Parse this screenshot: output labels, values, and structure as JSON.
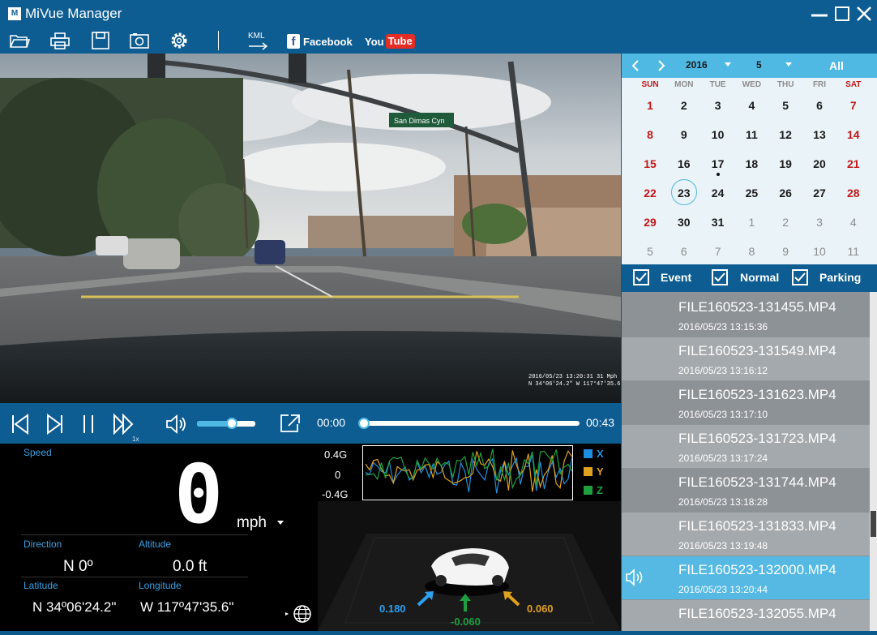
{
  "window": {
    "title": "MiVue Manager",
    "logo_text": "M"
  },
  "toolbar": {
    "icons": [
      "open-folder-icon",
      "print-icon",
      "save-icon",
      "snapshot-icon",
      "settings-icon",
      "kml-export-icon"
    ],
    "kml_label": "KML",
    "facebook_label": "Facebook",
    "youtube_you": "You",
    "youtube_tube": "Tube"
  },
  "video": {
    "overlay_line1": "2016/05/23 13:20:31 31 Mph",
    "overlay_line2": "N 34°06'24.2\" W 117°47'35.6\"",
    "street_sign": "San Dimas Cyn"
  },
  "player": {
    "speed_label": "1x",
    "current_time": "00:00",
    "total_time": "00:43",
    "progress": 0.0,
    "volume": 0.6
  },
  "dashboard": {
    "speed_label": "Speed",
    "speed_value": "0",
    "speed_unit": "mph",
    "direction_label": "Direction",
    "direction_value": "N 0º",
    "altitude_label": "Altitude",
    "altitude_value": "0.0  ft",
    "latitude_label": "Latitude",
    "latitude_value": "N 34º06'24.2\"",
    "longitude_label": "Longitude",
    "longitude_value": "W 117º47'35.6\""
  },
  "gsensor": {
    "top_label": "0.4G",
    "mid_label": "0",
    "bottom_label": "-0.4G",
    "legend": [
      {
        "name": "X",
        "color": "#1e8fe0"
      },
      {
        "name": "Y",
        "color": "#e0a020"
      },
      {
        "name": "Z",
        "color": "#1ea040"
      }
    ],
    "x_value": "0.180",
    "y_value": "0.060",
    "z_value": "-0.060"
  },
  "calendar": {
    "year": "2016",
    "month": "5",
    "all_label": "All",
    "weekdays": [
      "SUN",
      "MON",
      "TUE",
      "WED",
      "THU",
      "FRI",
      "SAT"
    ],
    "weeks": [
      [
        "1",
        "2",
        "3",
        "4",
        "5",
        "6",
        "7"
      ],
      [
        "8",
        "9",
        "10",
        "11",
        "12",
        "13",
        "14"
      ],
      [
        "15",
        "16",
        "17",
        "18",
        "19",
        "20",
        "21"
      ],
      [
        "22",
        "23",
        "24",
        "25",
        "26",
        "27",
        "28"
      ],
      [
        "29",
        "30",
        "31",
        "1",
        "2",
        "3",
        "4"
      ],
      [
        "5",
        "6",
        "7",
        "8",
        "9",
        "10",
        "11"
      ]
    ],
    "selected_day": "23",
    "marked_day": "17"
  },
  "filters": [
    {
      "label": "Event",
      "checked": true
    },
    {
      "label": "Normal",
      "checked": true
    },
    {
      "label": "Parking",
      "checked": true
    }
  ],
  "files": [
    {
      "name": "FILE160523-131455.MP4",
      "date": "2016/05/23   13:15:36"
    },
    {
      "name": "FILE160523-131549.MP4",
      "date": "2016/05/23   13:16:12"
    },
    {
      "name": "FILE160523-131623.MP4",
      "date": "2016/05/23   13:17:10"
    },
    {
      "name": "FILE160523-131723.MP4",
      "date": "2016/05/23   13:17:24"
    },
    {
      "name": "FILE160523-131744.MP4",
      "date": "2016/05/23   13:18:28"
    },
    {
      "name": "FILE160523-131833.MP4",
      "date": "2016/05/23   13:19:48"
    },
    {
      "name": "FILE160523-132000.MP4",
      "date": "2016/05/23   13:20:44"
    },
    {
      "name": "FILE160523-132055.MP4",
      "date": ""
    }
  ],
  "playing_file_index": 6
}
